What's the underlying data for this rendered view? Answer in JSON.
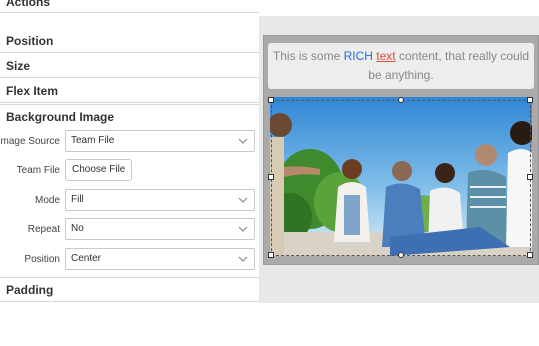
{
  "panel": {
    "sections": {
      "actions": "Actions",
      "position": "Position",
      "size": "Size",
      "flex_item": "Flex Item",
      "background_image": "Background Image",
      "padding": "Padding"
    },
    "background_image": {
      "image_source": {
        "label": "Image Source",
        "value": "Team File"
      },
      "team_file": {
        "label": "Team File",
        "button": "Choose File"
      },
      "mode": {
        "label": "Mode",
        "value": "Fill"
      },
      "repeat": {
        "label": "Repeat",
        "value": "No"
      },
      "position": {
        "label": "Position",
        "value": "Center"
      }
    }
  },
  "canvas": {
    "text_widget": {
      "part1": "This is some ",
      "rich": "RICH",
      "part2": " ",
      "link": "text",
      "part3": " content, that really could be anything."
    },
    "image_widget": {
      "description_icon": "photo-image-icon"
    }
  },
  "colors": {
    "rich_text": "#2a6fd6",
    "link_text": "#e04a3a",
    "canvas_background": "#e8e8e8",
    "widget_background": "#aaaaaa"
  }
}
